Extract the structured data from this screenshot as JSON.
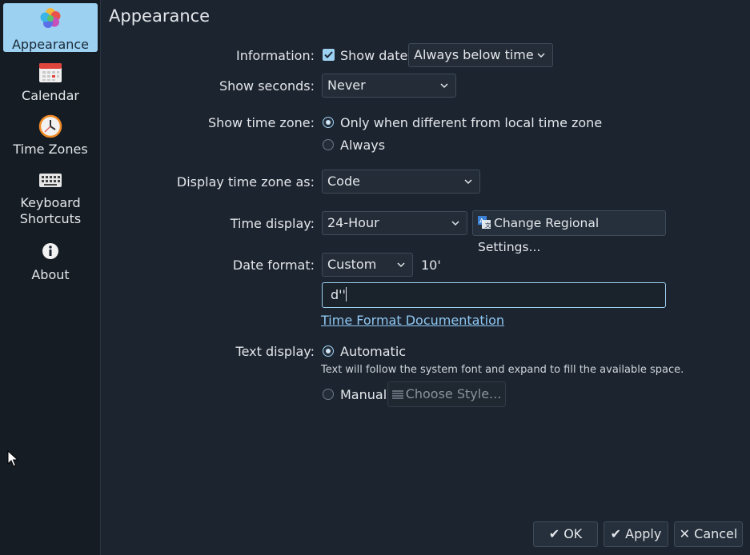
{
  "sidebar": {
    "items": [
      {
        "label": "Appearance",
        "icon": "appearance-icon",
        "active": true
      },
      {
        "label": "Calendar",
        "icon": "calendar-icon"
      },
      {
        "label": "Time Zones",
        "icon": "clock-icon"
      },
      {
        "label": "Keyboard\nShortcuts",
        "label1": "Keyboard",
        "label2": "Shortcuts",
        "icon": "keyboard-icon"
      },
      {
        "label": "About",
        "icon": "info-icon"
      }
    ]
  },
  "main": {
    "title": "Appearance",
    "information": {
      "label": "Information:",
      "checkbox_label": "Show date",
      "checked": true,
      "combo_value": "Always below time"
    },
    "show_seconds": {
      "label": "Show seconds:",
      "value": "Never"
    },
    "show_timezone": {
      "label": "Show time zone:",
      "option1": "Only when different from local time zone",
      "option2": "Always"
    },
    "display_tz_as": {
      "label": "Display time zone as:",
      "value": "Code"
    },
    "time_display": {
      "label": "Time display:",
      "value": "24-Hour",
      "button": "Change Regional Settings..."
    },
    "date_format": {
      "label": "Date format:",
      "value": "Custom",
      "preview": "10'",
      "input_value": "d''",
      "doc_link": "Time Format Documentation"
    },
    "text_display": {
      "label": "Text display:",
      "option_auto": "Automatic",
      "hint": "Text will follow the system font and expand to fill the available space.",
      "option_manual": "Manual",
      "choose_style": "Choose Style..."
    }
  },
  "footer": {
    "ok": "OK",
    "apply": "Apply",
    "cancel": "Cancel"
  },
  "colors": {
    "accent": "#9dd1f2",
    "background": "#1c2430",
    "sidebar": "#151c24"
  }
}
